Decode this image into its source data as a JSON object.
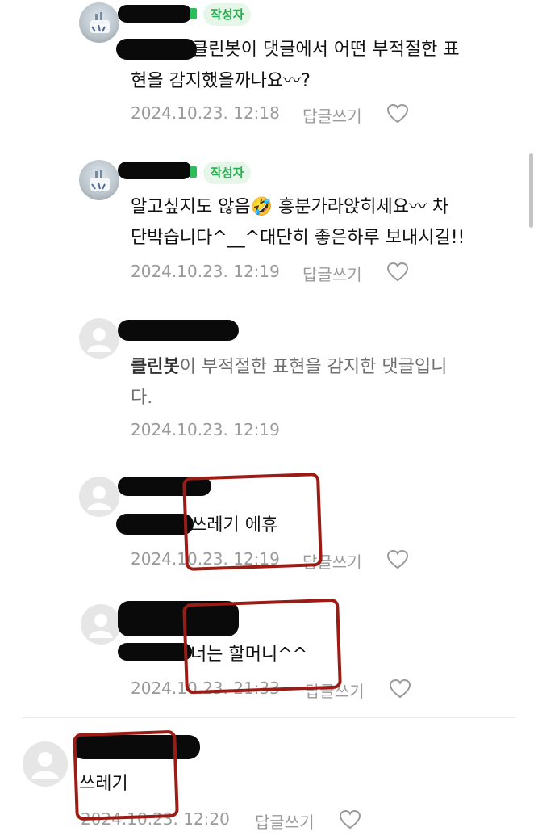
{
  "comments": [
    {
      "author_badge": "작성자",
      "text_line1": "클린봇이 댓글에서 어떤 부적절한 표",
      "text_line2": "현을 감지했을까나요〰?",
      "date": "2024.10.23. 12:18",
      "reply_label": "답글쓰기"
    },
    {
      "author_badge": "작성자",
      "text_line1": "알고싶지도 않음🤣 흥분가라앉히세요〰 차",
      "text_line2": "단박습니다^__^대단히 좋은하루 보내시길!!",
      "date": "2024.10.23. 12:19",
      "reply_label": "답글쓰기"
    },
    {
      "cleanbot_name": "클린봇",
      "text_line1_rest": "이 부적절한 표현을 감지한 댓글입니",
      "text_line2": "다.",
      "date": "2024.10.23. 12:19"
    },
    {
      "text": "쓰레기 에휴",
      "date": "2024.10.23. 12:19",
      "reply_label": "답글쓰기"
    },
    {
      "text": "너는 할머니^^",
      "date": "2024.10.23. 21:33",
      "reply_label": "답글쓰기"
    },
    {
      "text": "쓰레기",
      "date": "2024.10.23. 12:20",
      "reply_label": "답글쓰기"
    }
  ],
  "colors": {
    "annotation_red": "#9b1c14",
    "badge_green": "#27b04f",
    "meta_gray": "#9a9a9a"
  },
  "icons": {
    "like": "heart-icon",
    "avatar_default": "person-icon"
  }
}
